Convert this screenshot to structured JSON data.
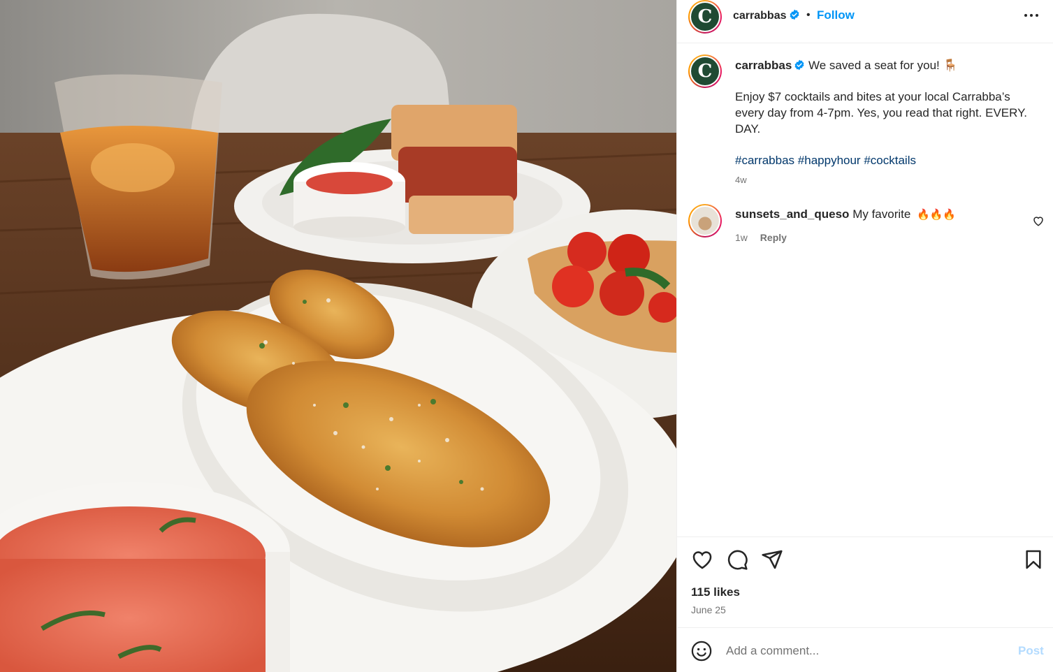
{
  "post": {
    "username": "carrabbas",
    "avatar_letter": "C",
    "follow_label": "Follow",
    "separator": "•",
    "caption_headline": "We saved a seat for you! 🪑",
    "caption_body": "Enjoy $7 cocktails and bites at your local Carrabba’s every day from 4-7pm. Yes, you read that right. EVERY. DAY.",
    "hashtags": [
      "#carrabbas",
      "#happyhour",
      "#cocktails"
    ],
    "caption_age": "4w",
    "likes": "115 likes",
    "date": "June 25"
  },
  "comments": [
    {
      "username": "sunsets_and_queso",
      "text": "My favorite",
      "emoji": "🔥🔥🔥",
      "age": "1w",
      "reply_label": "Reply"
    }
  ],
  "composer": {
    "placeholder": "Add a comment...",
    "post_label": "Post"
  },
  "colors": {
    "brand_green": "#1f4a33",
    "follow_blue": "#0095f6",
    "hashtag_blue": "#00376b",
    "muted": "#737373"
  },
  "icons": [
    "verified-badge-icon",
    "more-options-icon",
    "like-heart-icon",
    "comment-icon",
    "share-icon",
    "save-bookmark-icon",
    "emoji-icon",
    "comment-like-icon"
  ]
}
